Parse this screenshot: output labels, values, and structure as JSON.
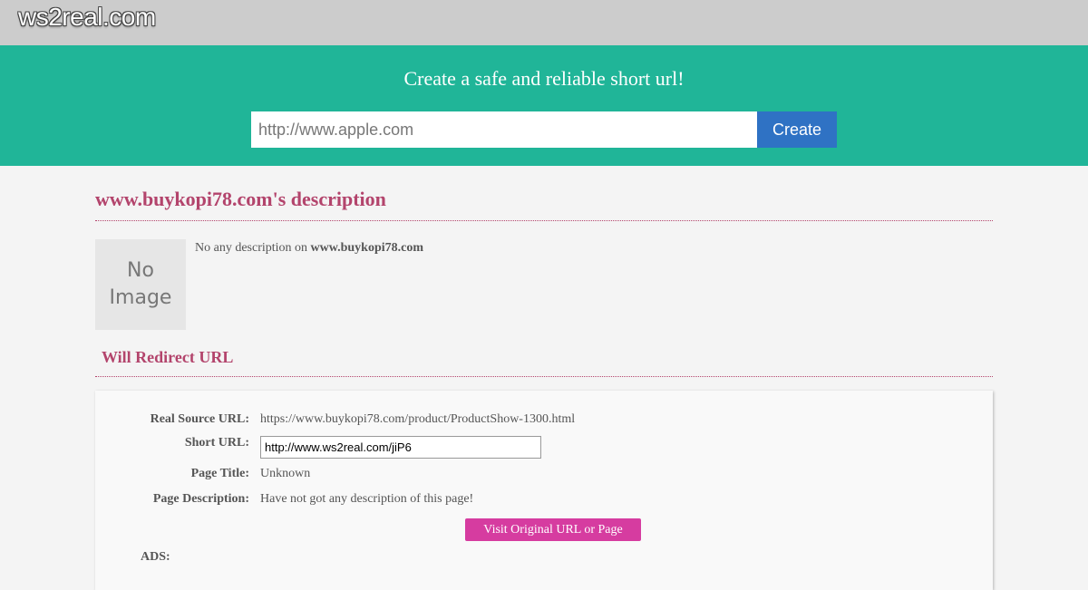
{
  "header": {
    "logo": "ws2real.com"
  },
  "hero": {
    "title": "Create a safe and reliable short url!",
    "input_placeholder": "http://www.apple.com",
    "create_label": "Create"
  },
  "description": {
    "title": "www.buykopi78.com's description",
    "no_image_line1": "No",
    "no_image_line2": "Image",
    "text_prefix": "No any description on ",
    "site": "www.buykopi78.com"
  },
  "redirect": {
    "title": "Will Redirect URL",
    "real_source_label": "Real Source URL:",
    "real_source_value": "https://www.buykopi78.com/product/ProductShow-1300.html",
    "short_url_label": "Short URL:",
    "short_url_value": "http://www.ws2real.com/jiP6",
    "page_title_label": "Page Title:",
    "page_title_value": "Unknown",
    "page_desc_label": "Page Description:",
    "page_desc_value": "Have not got any description of this page!",
    "visit_label": "Visit Original URL or Page",
    "ads_label": "ADS:"
  }
}
